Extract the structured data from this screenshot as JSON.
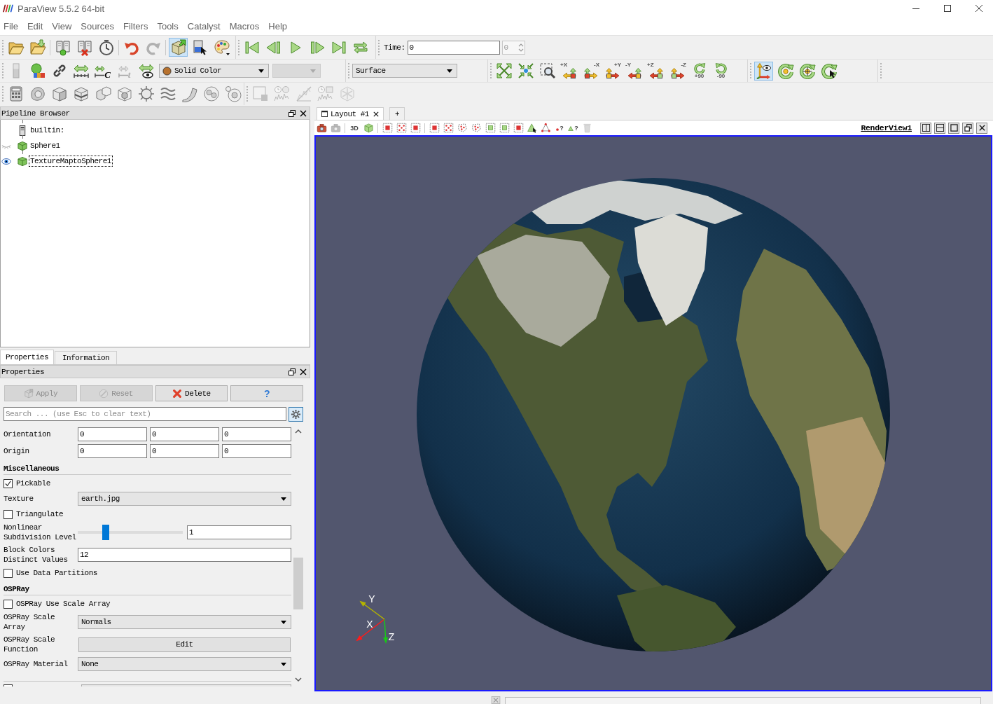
{
  "window": {
    "title": "ParaView 5.5.2 64-bit"
  },
  "menu": [
    "File",
    "Edit",
    "View",
    "Sources",
    "Filters",
    "Tools",
    "Catalyst",
    "Macros",
    "Help"
  ],
  "toolbar_rows": [
    [
      {
        "buttons": [
          {
            "pressed": false,
            "disabled": false
          },
          {
            "pressed": false,
            "disabled": false
          },
          {
            "pressed": false,
            "disabled": false
          },
          {
            "pressed": false,
            "disabled": false
          },
          {
            "pressed": false,
            "disabled": false
          },
          {
            "pressed": false,
            "disabled": false
          },
          {
            "pressed": false,
            "disabled": true
          },
          {
            "pressed": true,
            "disabled": false
          },
          {
            "pressed": false,
            "disabled": false
          },
          {
            "pressed": false,
            "disabled": false
          }
        ]
      },
      {
        "buttons": [
          {
            "pressed": false,
            "disabled": false
          },
          {
            "pressed": false,
            "disabled": false
          },
          {
            "pressed": false,
            "disabled": false
          },
          {
            "pressed": false,
            "disabled": false
          },
          {
            "pressed": false,
            "disabled": false
          },
          {
            "pressed": false,
            "disabled": false
          }
        ]
      },
      {
        "controls": [
          {
            "kind": "label",
            "text": "Time:",
            "disabled": false
          },
          {
            "kind": "field",
            "value": "0",
            "disabled": false
          },
          {
            "kind": "spinbox",
            "value": "0",
            "disabled": true
          }
        ]
      }
    ],
    [
      {
        "buttons": [
          {
            "pressed": false,
            "disabled": true
          },
          {
            "pressed": false,
            "disabled": false
          },
          {
            "pressed": false,
            "disabled": false
          },
          {
            "pressed": false,
            "disabled": false
          },
          {
            "label": "C",
            "pressed": false,
            "disabled": false
          },
          {
            "label": "t",
            "pressed": false,
            "disabled": true
          },
          {
            "pressed": false,
            "disabled": false
          }
        ],
        "controls": [
          {
            "kind": "dropdown",
            "value": "Solid Color",
            "disabled": false
          },
          {
            "kind": "dropdown",
            "disabled": true
          }
        ]
      },
      {
        "controls": [
          {
            "kind": "dropdown",
            "value": "Surface",
            "disabled": false
          }
        ]
      },
      {
        "buttons": [
          {
            "pressed": false,
            "disabled": false
          },
          {
            "pressed": false,
            "disabled": false
          },
          {
            "pressed": false,
            "disabled": false
          },
          {
            "label": "+X",
            "pressed": false,
            "disabled": false
          },
          {
            "label": "-X",
            "pressed": false,
            "disabled": false
          },
          {
            "label": "+Y",
            "pressed": false,
            "disabled": false
          },
          {
            "label": "-Y",
            "pressed": false,
            "disabled": false
          },
          {
            "label": "+Z",
            "pressed": false,
            "disabled": false
          },
          {
            "label": "-Z",
            "pressed": false,
            "disabled": false
          },
          {
            "label": "+90",
            "pressed": false,
            "disabled": false
          },
          {
            "label": "-90",
            "pressed": false,
            "disabled": false
          }
        ]
      },
      {
        "buttons": [
          {
            "pressed": true,
            "disabled": false
          },
          {
            "pressed": false,
            "disabled": false
          },
          {
            "pressed": false,
            "disabled": false
          },
          {
            "pressed": false,
            "disabled": false
          }
        ]
      }
    ],
    [
      {
        "buttons": [
          {
            "pressed": false,
            "disabled": false
          },
          {
            "pressed": false,
            "disabled": false
          },
          {
            "pressed": false,
            "disabled": false
          },
          {
            "pressed": false,
            "disabled": false
          },
          {
            "pressed": false,
            "disabled": false
          },
          {
            "pressed": false,
            "disabled": false
          },
          {
            "pressed": false,
            "disabled": false
          },
          {
            "pressed": false,
            "disabled": false
          },
          {
            "pressed": false,
            "disabled": false
          },
          {
            "pressed": false,
            "disabled": false
          },
          {
            "pressed": false,
            "disabled": false
          }
        ]
      },
      {
        "buttons": [
          {
            "pressed": false,
            "disabled": true
          },
          {
            "pressed": false,
            "disabled": true
          },
          {
            "pressed": false,
            "disabled": true
          },
          {
            "pressed": false,
            "disabled": true
          },
          {
            "pressed": false,
            "disabled": true
          }
        ]
      }
    ]
  ],
  "pipeline_browser": {
    "title": "Pipeline Browser",
    "items": [
      {
        "label": "builtin:",
        "kind": "server",
        "selected": false,
        "children": [
          {
            "label": "Sphere1",
            "kind": "source",
            "visible": false,
            "selected": false,
            "children": [
              {
                "label": "TextureMaptoSphere1",
                "kind": "source",
                "visible": true,
                "selected": true
              }
            ]
          }
        ]
      }
    ]
  },
  "panel_tabs": [
    {
      "label": "Properties",
      "selected": true
    },
    {
      "label": "Information",
      "selected": false
    }
  ],
  "properties": {
    "title": "Properties",
    "buttons": [
      {
        "label": "Apply",
        "kind": "apply",
        "disabled": true
      },
      {
        "label": "Reset",
        "kind": "reset",
        "disabled": true
      },
      {
        "label": "Delete",
        "kind": "delete",
        "disabled": false
      },
      {
        "label": "?",
        "kind": "help",
        "disabled": false
      }
    ],
    "search": {
      "placeholder": "Search ... (use Esc to clear text)"
    },
    "advanced_button": {
      "pressed": true
    },
    "rows": [
      {
        "kind": "triple",
        "label": "Orientation",
        "values": [
          "0",
          "0",
          "0"
        ]
      },
      {
        "kind": "triple",
        "label": "Origin",
        "values": [
          "0",
          "0",
          "0"
        ]
      },
      {
        "kind": "section",
        "label": "Miscellaneous"
      },
      {
        "kind": "checkbox",
        "label": "Pickable",
        "checked": true
      },
      {
        "kind": "dropdown",
        "label": "Texture",
        "value": "earth.jpg"
      },
      {
        "kind": "checkbox",
        "label": "Triangulate",
        "checked": false
      },
      {
        "kind": "slider",
        "label": "Nonlinear Subdivision Level",
        "level": 0.25,
        "value": "1"
      },
      {
        "kind": "field",
        "label": "Block Colors Distinct Values",
        "value": "12"
      },
      {
        "kind": "checkbox",
        "label": "Use Data Partitions",
        "checked": false
      },
      {
        "kind": "section",
        "label": "OSPRay"
      },
      {
        "kind": "checkbox",
        "label": "OSPRay Use Scale Array",
        "checked": false
      },
      {
        "kind": "dropdown",
        "label": "OSPRay Scale Array",
        "value": "Normals"
      },
      {
        "kind": "button",
        "label": "OSPRay Scale Function",
        "value": "Edit"
      },
      {
        "kind": "dropdown",
        "label": "OSPRay Material",
        "value": "None"
      },
      {
        "kind": "clipped",
        "checked": false
      }
    ]
  },
  "layout_tabs": {
    "tabs": [
      {
        "label": "Layout #1",
        "selected": true
      }
    ],
    "add": "+"
  },
  "view_toolbar": {
    "buttons": [
      {
        "pressed": false,
        "disabled": false
      },
      {
        "pressed": false,
        "disabled": true
      },
      {
        "label": "3D",
        "pressed": false,
        "disabled": false
      },
      {
        "pressed": false,
        "disabled": false
      },
      {
        "pressed": false,
        "disabled": false
      },
      {
        "pressed": false,
        "disabled": false
      },
      {
        "pressed": false,
        "disabled": false
      },
      {
        "pressed": false,
        "disabled": false
      },
      {
        "pressed": false,
        "disabled": false
      },
      {
        "pressed": false,
        "disabled": false
      },
      {
        "pressed": false,
        "disabled": false
      },
      {
        "pressed": false,
        "disabled": false
      },
      {
        "pressed": false,
        "disabled": false
      },
      {
        "pressed": false,
        "disabled": false
      },
      {
        "pressed": false,
        "disabled": false
      },
      {
        "pressed": false,
        "disabled": false
      },
      {
        "label": "?",
        "pressed": false,
        "disabled": false
      },
      {
        "label": "?",
        "pressed": false,
        "disabled": false
      },
      {
        "pressed": false,
        "disabled": true
      }
    ],
    "view_name": "RenderView1"
  },
  "orientation_axes": [
    {
      "label": "Y",
      "color": "#b4b400"
    },
    {
      "label": "X",
      "color": "#ff1a1a"
    },
    {
      "label": "Z",
      "color": "#19c819"
    }
  ]
}
